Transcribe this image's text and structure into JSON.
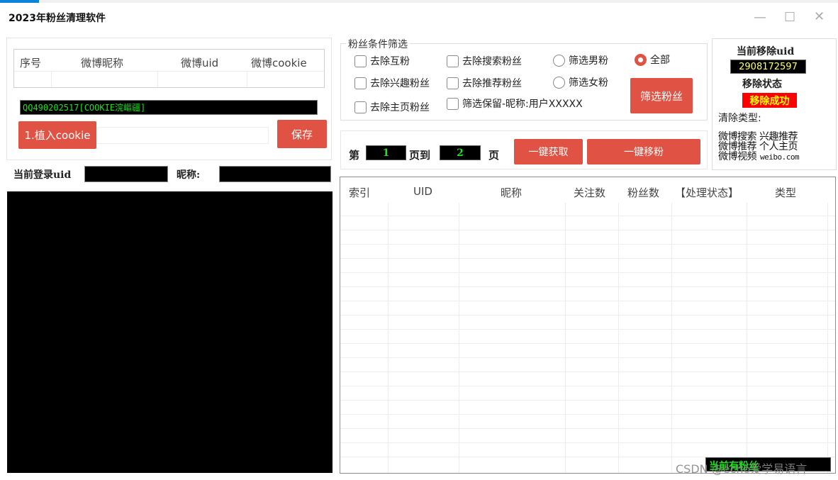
{
  "app": {
    "title": "2023年粉丝清理软件"
  },
  "window_controls": {
    "minimize": "—",
    "maximize": "☐",
    "close": "✕"
  },
  "cookie_table": {
    "headers": [
      "序号",
      "微博昵称",
      "微博uid",
      "微博cookie"
    ]
  },
  "cookie_input": {
    "value": "QQ490202517[COOKIE浣嶇疆]"
  },
  "buttons": {
    "import_cookie": "1.植入cookie",
    "save": "保存",
    "filter_fans": "筛选粉丝",
    "fetch_one_click": "一键获取",
    "remove_one_click": "一键移粉"
  },
  "login": {
    "uid_label": "当前登录uid",
    "nick_label": "昵称:"
  },
  "filter": {
    "group_title": "粉丝条件筛选",
    "options": {
      "remove_mutual": "去除互粉",
      "remove_search": "去除搜索粉丝",
      "filter_male": "筛选男粉",
      "all": "全部",
      "remove_interest": "去除兴趣粉丝",
      "remove_recommend": "去除推荐粉丝",
      "filter_female": "筛选女粉",
      "remove_homepage": "去除主页粉丝",
      "keep_nickname": "筛选保留-昵称:用户XXXXX"
    }
  },
  "paging": {
    "prefix": "第",
    "from_page": "1",
    "mid": "页到",
    "to_page": "2",
    "suffix": "页"
  },
  "status_panel": {
    "current_uid_label": "当前移除uid",
    "current_uid": "2908172597",
    "state_label": "移除状态",
    "state_value": "移除成功",
    "clear_type_label": "清除类型:",
    "types_line1": "微博搜索 兴趣推荐",
    "types_line2": "微博推荐 个人主页",
    "types_line3": "微博视频",
    "site": "weibo.com"
  },
  "result_table": {
    "headers": [
      "索引",
      "UID",
      "昵称",
      "关注数",
      "粉丝数",
      "【处理状态】",
      "类型"
    ]
  },
  "footer": {
    "overlay_text": "当前有粉丝",
    "watermark": "CSDN @echo爱学易语言"
  },
  "colors": {
    "accent_red": "#e05243",
    "terminal_green": "#19e619",
    "state_bg": "#ff0000",
    "state_text": "#ffff00"
  }
}
